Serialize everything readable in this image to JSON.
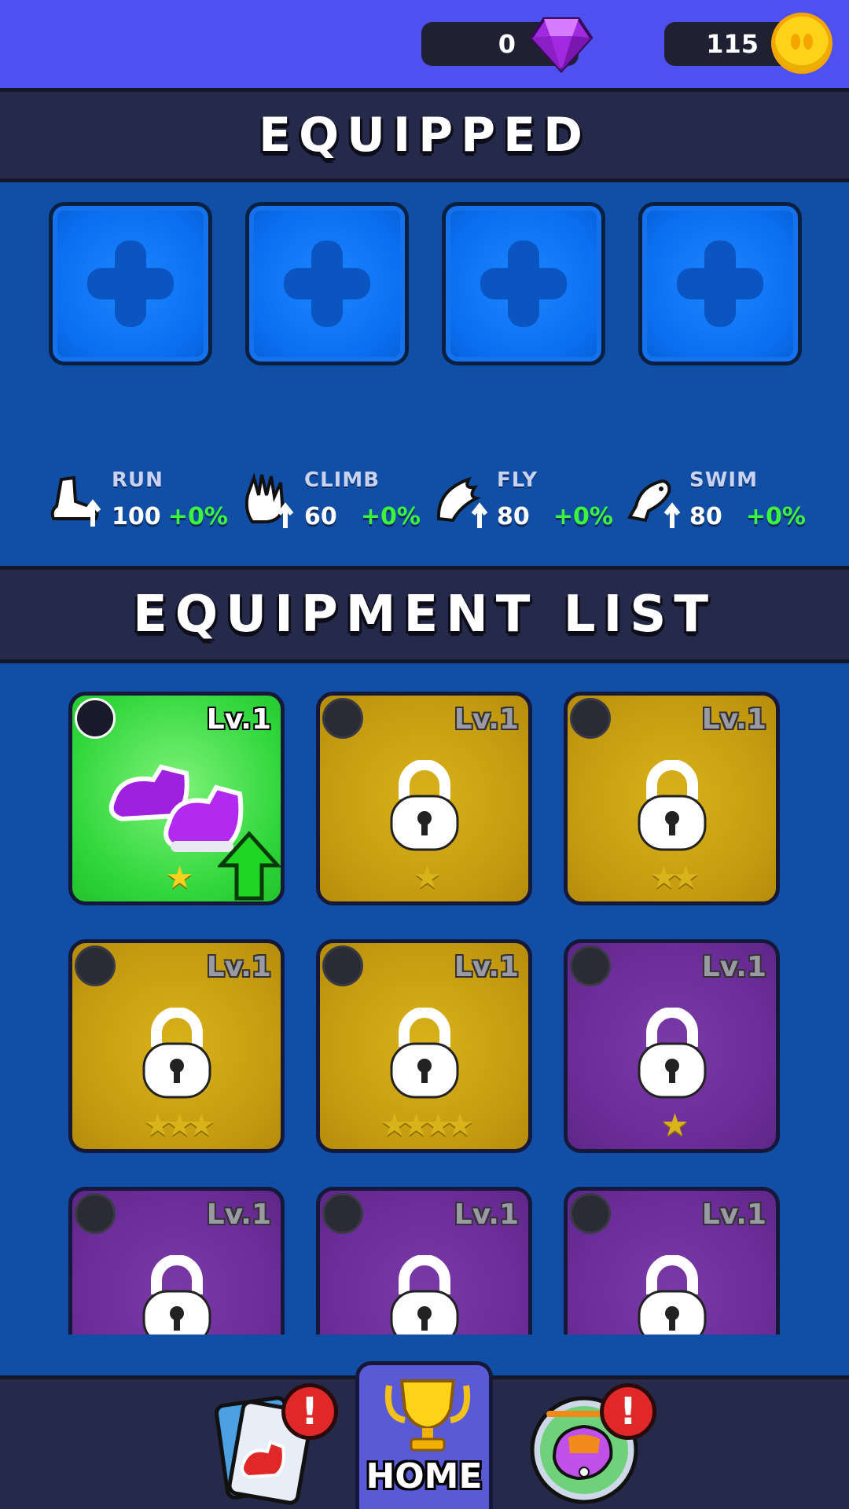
{
  "currency": {
    "gems": "0",
    "coins": "115"
  },
  "equipped": {
    "title": "EQUIPPED",
    "slots": 4
  },
  "stats": [
    {
      "name": "RUN",
      "value": "100",
      "bonus": "+0%",
      "icon": "run-boot-icon"
    },
    {
      "name": "CLIMB",
      "value": "60",
      "bonus": "+0%",
      "icon": "climb-glove-icon"
    },
    {
      "name": "FLY",
      "value": "80",
      "bonus": "+0%",
      "icon": "fly-wing-icon"
    },
    {
      "name": "SWIM",
      "value": "80",
      "bonus": "+0%",
      "icon": "swim-fish-icon"
    }
  ],
  "equipment_list": {
    "title": "EQUIPMENT LIST",
    "items": [
      {
        "level": "Lv.1",
        "rarity": "green",
        "type": "boot",
        "stars": 1,
        "locked": false,
        "upgrade": true
      },
      {
        "level": "Lv.1",
        "rarity": "yellow",
        "type": "glove",
        "stars": 1,
        "locked": true
      },
      {
        "level": "Lv.1",
        "rarity": "yellow",
        "type": "glove",
        "stars": 2,
        "locked": true
      },
      {
        "level": "Lv.1",
        "rarity": "yellow",
        "type": "hat",
        "stars": 3,
        "locked": true
      },
      {
        "level": "Lv.1",
        "rarity": "yellow",
        "type": "armor",
        "stars": 4,
        "locked": true
      },
      {
        "level": "Lv.1",
        "rarity": "purple",
        "type": "glove",
        "stars": 1,
        "locked": true
      },
      {
        "level": "Lv.1",
        "rarity": "purple",
        "type": "armor",
        "stars": 0,
        "locked": true
      },
      {
        "level": "Lv.1",
        "rarity": "purple",
        "type": "armor",
        "stars": 0,
        "locked": true
      },
      {
        "level": "Lv.1",
        "rarity": "purple",
        "type": "boot",
        "stars": 0,
        "locked": true
      }
    ]
  },
  "nav": {
    "home_label": "HOME",
    "alert_symbol": "!"
  },
  "colors": {
    "top_bar": "#4f50f0",
    "background": "#114fa6",
    "header": "#25294a",
    "bonus": "#3df53d"
  }
}
